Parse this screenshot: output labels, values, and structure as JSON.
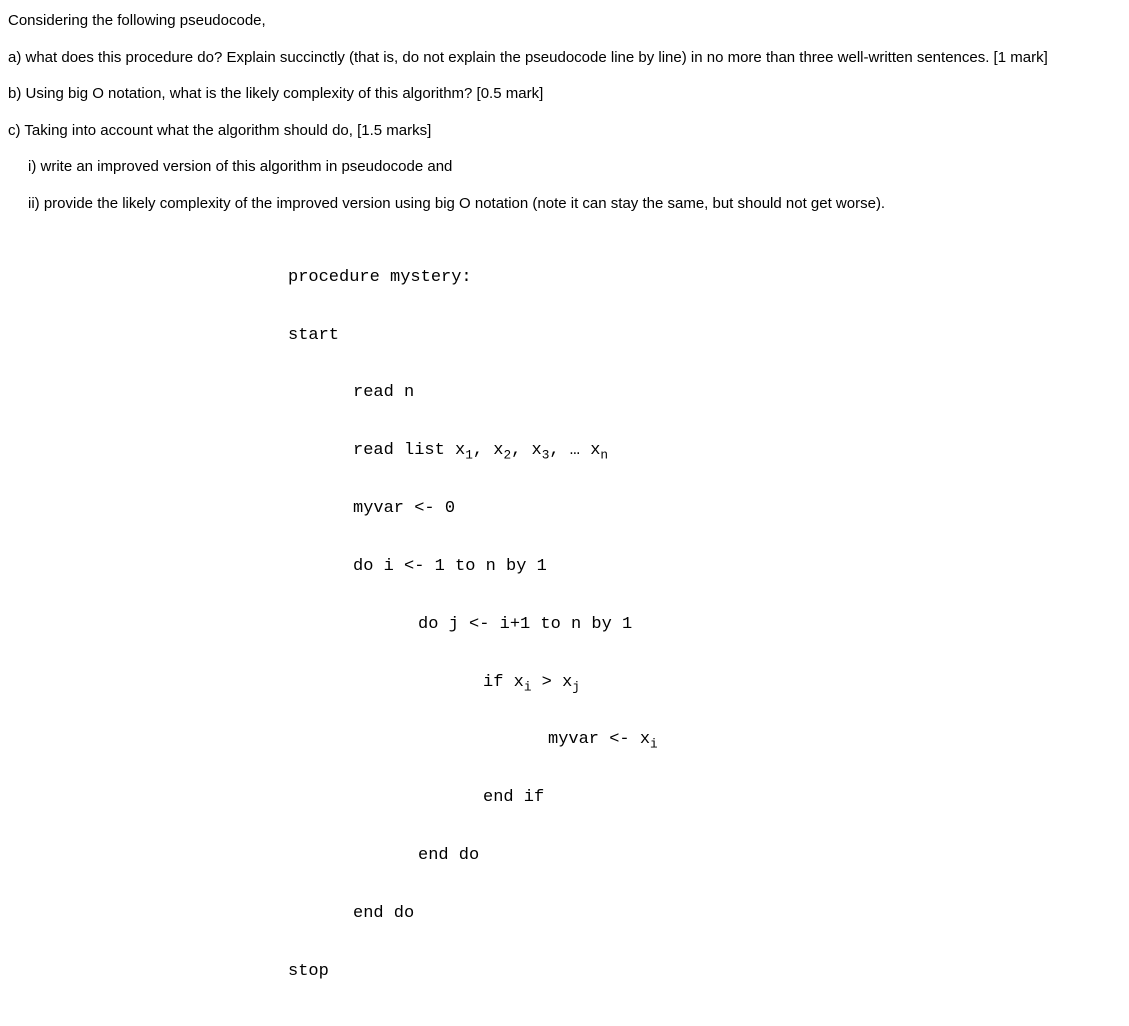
{
  "intro": "Considering the following pseudocode,",
  "qa": "a) what does this procedure do? Explain succinctly (that is, do not explain the pseudocode line by line) in no more than three well-written sentences. [1 mark]",
  "qb": "b) Using big O notation, what is the likely complexity of this algorithm? [0.5 mark]",
  "qc": "c)  Taking into account what the algorithm should do, [1.5 marks]",
  "qci": "i) write an improved version of this algorithm in pseudocode and",
  "qcii": "ii) provide the likely complexity of the improved version using big O notation (note it can stay the same, but should not get worse).",
  "code": {
    "l1": "procedure mystery:",
    "l2": "start",
    "l3": "read n",
    "l4a": "read list x",
    "l4b": ", x",
    "l4c": ", x",
    "l4d": ", … x",
    "s1": "1",
    "s2": "2",
    "s3": "3",
    "sn": "n",
    "l5": "myvar <- 0",
    "l6": "do i <- 1 to n by 1",
    "l7": "do j <- i+1 to n by 1",
    "l8a": "if x",
    "l8b": " > x",
    "si": "i",
    "sj": "j",
    "l9a": "myvar <- x",
    "l10": "end if",
    "l11": "end do",
    "l12": "end do",
    "l13": "stop"
  }
}
